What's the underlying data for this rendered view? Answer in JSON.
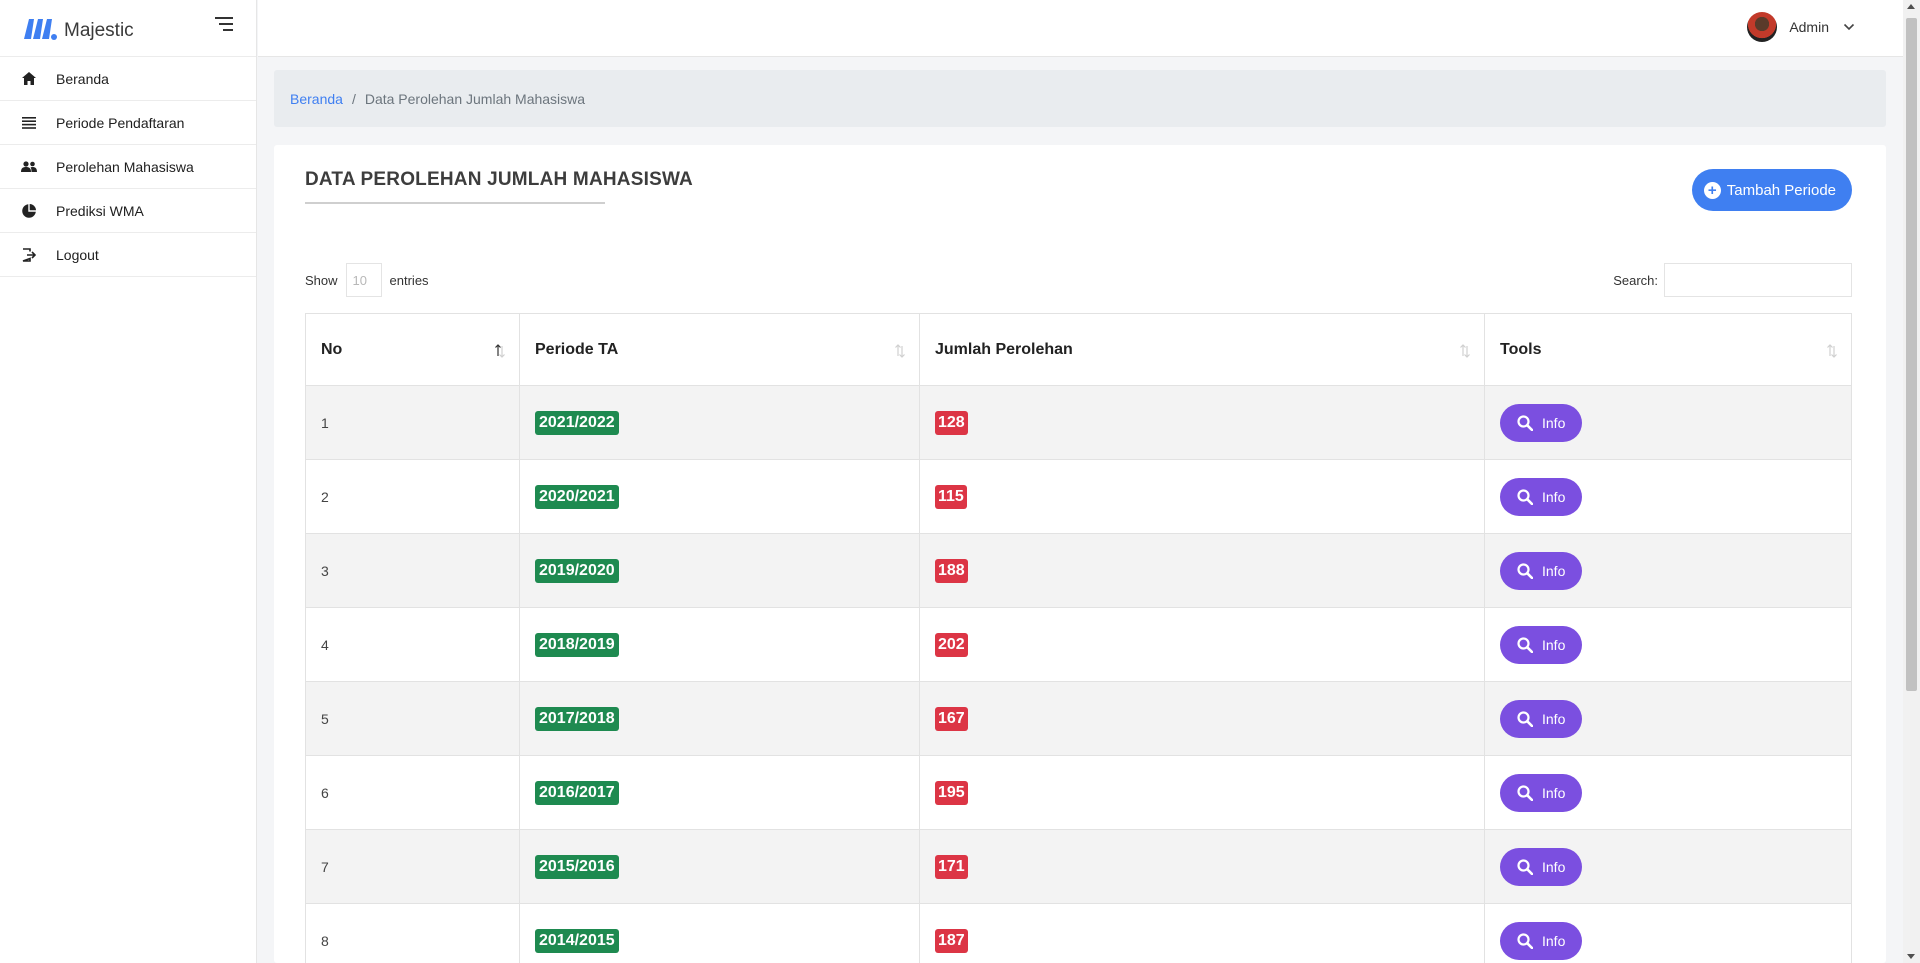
{
  "brand": {
    "name": "Majestic",
    "color": "#3f7ff1"
  },
  "sidebar": {
    "items": [
      {
        "label": "Beranda",
        "icon": "home-icon"
      },
      {
        "label": "Periode Pendaftaran",
        "icon": "list-icon"
      },
      {
        "label": "Perolehan Mahasiswa",
        "icon": "people-icon"
      },
      {
        "label": "Prediksi WMA",
        "icon": "pie-chart-icon"
      },
      {
        "label": "Logout",
        "icon": "logout-icon"
      }
    ]
  },
  "topbar": {
    "user_name": "Admin"
  },
  "breadcrumb": {
    "home": "Beranda",
    "separator": "/",
    "current": "Data Perolehan Jumlah Mahasiswa"
  },
  "main": {
    "title": "DATA PEROLEHAN JUMLAH MAHASISWA",
    "add_button_label": "Tambah Periode",
    "show_label": "Show",
    "entries_value": "10",
    "entries_label": "entries",
    "search_label": "Search:",
    "search_value": ""
  },
  "table": {
    "headers": [
      "No",
      "Periode TA",
      "Jumlah Perolehan",
      "Tools"
    ],
    "rows": [
      {
        "no": "1",
        "periode": "2021/2022",
        "jumlah": "128",
        "tool": "Info"
      },
      {
        "no": "2",
        "periode": "2020/2021",
        "jumlah": "115",
        "tool": "Info"
      },
      {
        "no": "3",
        "periode": "2019/2020",
        "jumlah": "188",
        "tool": "Info"
      },
      {
        "no": "4",
        "periode": "2018/2019",
        "jumlah": "202",
        "tool": "Info"
      },
      {
        "no": "5",
        "periode": "2017/2018",
        "jumlah": "167",
        "tool": "Info"
      },
      {
        "no": "6",
        "periode": "2016/2017",
        "jumlah": "195",
        "tool": "Info"
      },
      {
        "no": "7",
        "periode": "2015/2016",
        "jumlah": "171",
        "tool": "Info"
      },
      {
        "no": "8",
        "periode": "2014/2015",
        "jumlah": "187",
        "tool": "Info"
      }
    ]
  },
  "colors": {
    "accent": "#3f7ff1",
    "period_badge": "#1e8a50",
    "count_badge": "#dc3545",
    "info_button": "#7b4fe0"
  }
}
